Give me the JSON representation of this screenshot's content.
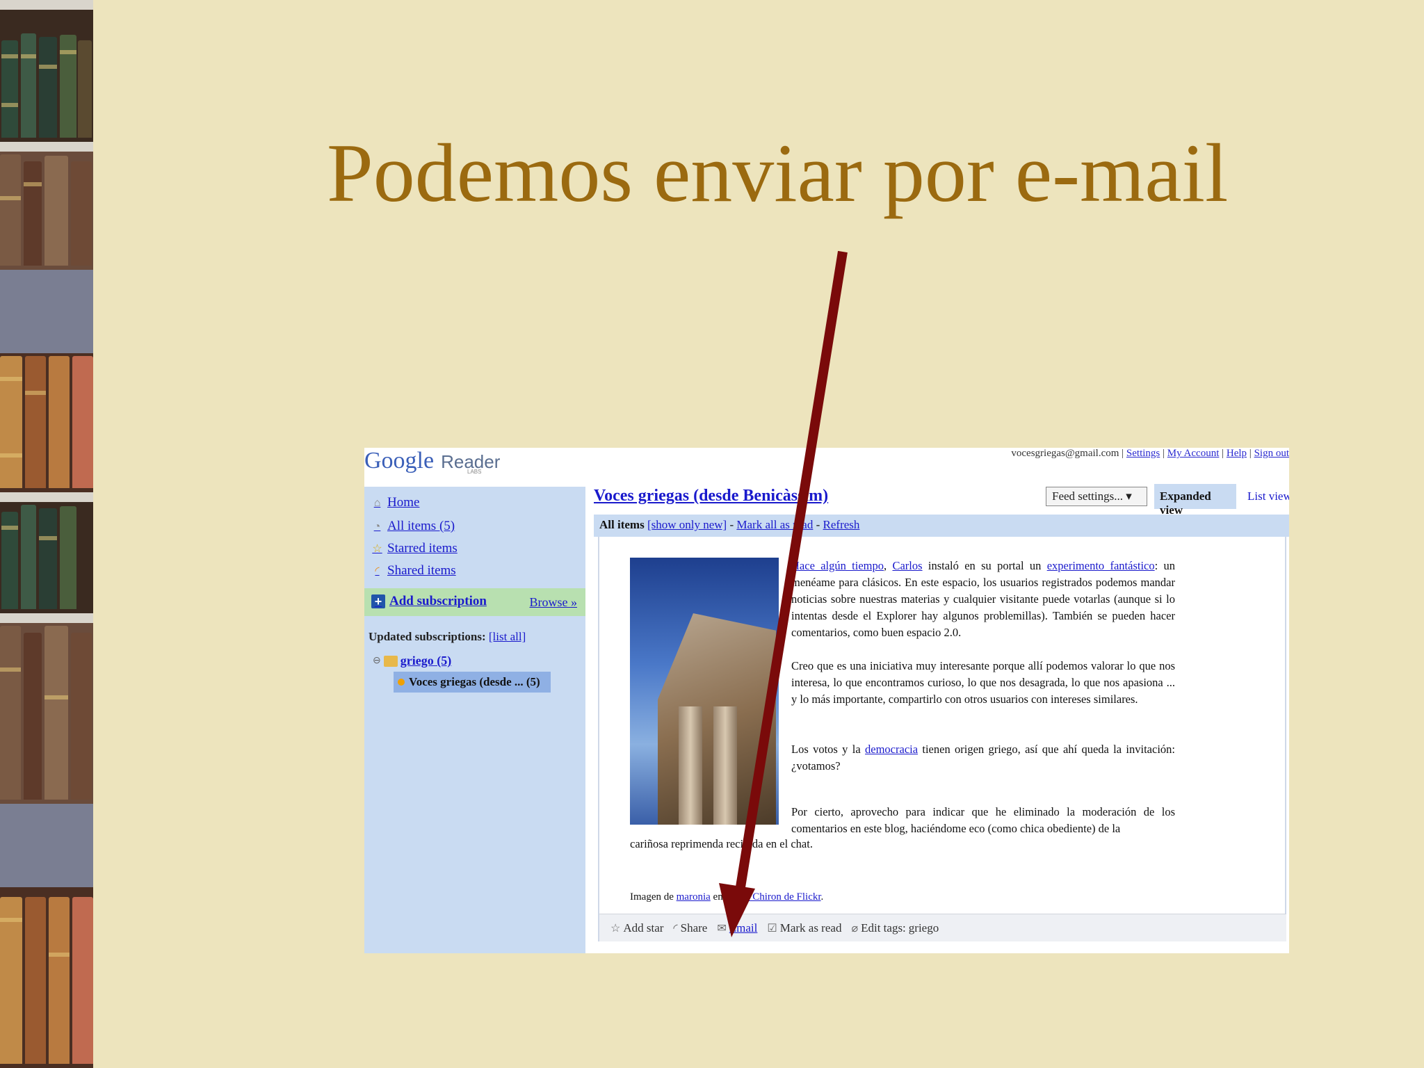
{
  "slide": {
    "title": "Podemos enviar por e-mail"
  },
  "reader": {
    "logo": {
      "g": "Google",
      "product": "Reader",
      "labs": "LABS"
    },
    "top_links": {
      "account": "vocesgriegas@gmail.com",
      "settings": "Settings",
      "my_account": "My Account",
      "help": "Help",
      "sign_out": "Sign out"
    },
    "sidebar": {
      "nav": [
        {
          "label": "Home",
          "icon": "home-icon"
        },
        {
          "label": "All items (5)",
          "icon": "all-items-icon"
        },
        {
          "label": "Starred items",
          "icon": "star-icon"
        },
        {
          "label": "Shared items",
          "icon": "share-icon"
        }
      ],
      "add_subscription": "Add subscription",
      "browse": "Browse »",
      "updated_label": "Updated subscriptions:",
      "list_all": "[list all]",
      "folder": "griego (5)",
      "feed": "Voces griegas (desde ... (5)"
    },
    "main": {
      "title": "Voces griegas (desde Benicàssim)",
      "feed_settings": "Feed settings...",
      "tabs": {
        "expanded": "Expanded view",
        "list": "List view"
      },
      "bar": {
        "all_items": "All items",
        "show_only_new": "[show only new]",
        "sep1": " - ",
        "mark_all_read": "Mark all as read",
        "sep2": " - ",
        "refresh": "Refresh"
      },
      "entry": {
        "p1_link1": "Hace algún tiempo",
        "p1_sep": ", ",
        "p1_link2": "Carlos",
        "p1_text1": " instaló en su portal un ",
        "p1_link3": "experimento fantástico",
        "p1_text2": ": un menéame para clásicos. En este espacio, los usuarios registrados podemos mandar noticias sobre nuestras materias y cualquier visitante puede votarlas (aunque si lo intentas desde el Explorer hay algunos problemillas). También se pueden hacer comentarios, como buen espacio 2.0.",
        "p2": "Creo que es una iniciativa muy interesante porque allí podemos valorar lo que nos interesa, lo que encontramos curioso, lo que nos desagrada, lo que nos apasiona ... y lo más importante, compartirlo con otros usuarios con intereses similares.",
        "p3_text1": "Los votos y la ",
        "p3_link": "democracia",
        "p3_text2": " tienen origen griego, así que ahí queda la invitación: ¿votamos?",
        "p4": "Por cierto, aprovecho para indicar que he eliminado la moderación de los comentarios en este blog, haciéndome eco (como chica obediente) de la",
        "p4_tail": "cariñosa reprimenda recibida en el chat.",
        "credit_text1": "Imagen de ",
        "credit_link1": "maronia",
        "credit_text2": " en ",
        "credit_link2": "grupo Chiron de Flickr",
        "credit_end": "."
      },
      "actions": {
        "add_star": "Add star",
        "share": "Share",
        "email": "Email",
        "mark_read": "Mark as read",
        "edit_tags": "Edit tags:",
        "tag": "griego"
      }
    }
  },
  "colors": {
    "background": "#ede4bd",
    "title": "#9b6a10",
    "arrow": "#7a0a0a",
    "sidebar": "#c9dbf2",
    "link": "#1a1acc"
  }
}
